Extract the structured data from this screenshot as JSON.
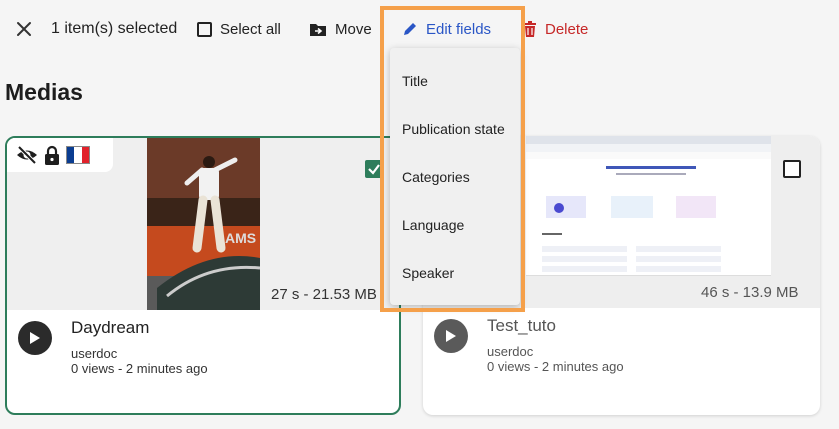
{
  "toolbar": {
    "selected_count": "1 item(s) selected",
    "select_all": "Select all",
    "move": "Move",
    "edit_fields": "Edit fields",
    "delete": "Delete"
  },
  "page_title": "Medias",
  "edit_menu": {
    "items": [
      "Title",
      "Publication state",
      "Categories",
      "Language",
      "Speaker"
    ]
  },
  "cards": [
    {
      "title": "Daydream",
      "duration_size": "27 s - 21.53 MB",
      "owner": "userdoc",
      "views": "0 views",
      "date": " - 2 minutes ago",
      "selected": true
    },
    {
      "title": "Test_tuto",
      "duration_size": "46 s - 13.9 MB",
      "owner": "userdoc",
      "views": "0 views",
      "date": " - 2 minutes ago",
      "selected": false
    }
  ],
  "colors": {
    "accent_blue": "#2a56c6",
    "delete_red": "#c62828",
    "selected_border": "#2e7d5b",
    "highlight_orange": "#f5a04a"
  }
}
